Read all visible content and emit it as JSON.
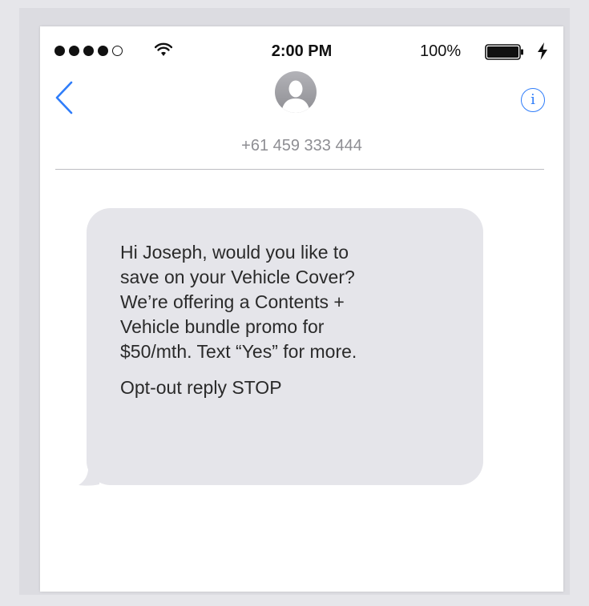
{
  "status_bar": {
    "signal_full": 4,
    "signal_total": 5,
    "time": "2:00 PM",
    "battery_percent": "100%",
    "battery_level": 1.0,
    "charging": true
  },
  "header": {
    "back_icon": "chevron-left-icon",
    "info_icon": "info-icon",
    "info_glyph": "i",
    "contact": "+61 459 333 444",
    "accent_color": "#2f7dfa"
  },
  "message": {
    "lines": [
      "Hi Joseph, would you like to",
      "save on your Vehicle Cover?",
      "We’re offering a Contents +",
      "Vehicle bundle promo for",
      "$50/mth. Text “Yes” for more."
    ],
    "optout": "Opt-out reply STOP",
    "bubble_color": "#e5e5ea"
  }
}
